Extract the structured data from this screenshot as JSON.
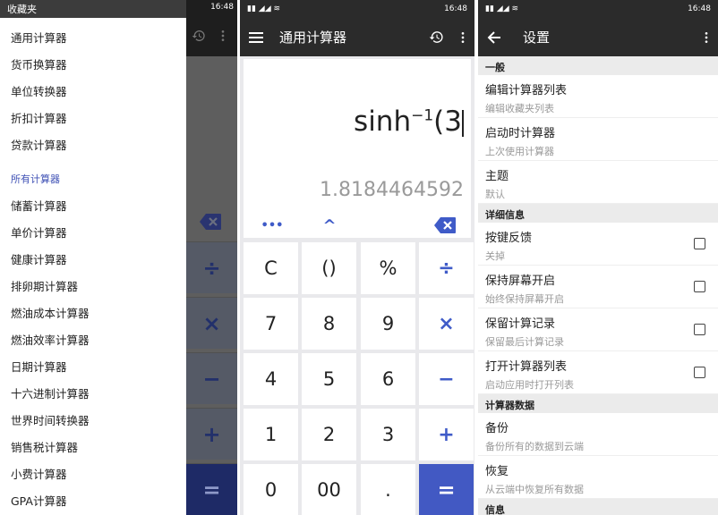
{
  "drawer": {
    "top_item": "收藏夹",
    "favorites": [
      "通用计算器",
      "货币换算器",
      "单位转换器",
      "折扣计算器",
      "贷款计算器"
    ],
    "section_title": "所有计算器",
    "all": [
      "储蓄计算器",
      "单价计算器",
      "健康计算器",
      "排卵期计算器",
      "燃油成本计算器",
      "燃油效率计算器",
      "日期计算器",
      "十六进制计算器",
      "世界时间转换器",
      "销售税计算器",
      "小费计算器",
      "GPA计算器"
    ]
  },
  "status": {
    "time": "16:48"
  },
  "calc": {
    "title": "通用计算器",
    "expr_main": "sinh",
    "expr_sup": "−1",
    "expr_tail": "(3",
    "result": "1.8184464592",
    "fn_more": "•••",
    "fn_power": "^",
    "keys": [
      [
        "C",
        "()",
        "%",
        "÷"
      ],
      [
        "7",
        "8",
        "9",
        "×"
      ],
      [
        "4",
        "5",
        "6",
        "−"
      ],
      [
        "1",
        "2",
        "3",
        "+"
      ],
      [
        "0",
        "00",
        ".",
        "="
      ]
    ]
  },
  "settings": {
    "title": "设置",
    "groups": [
      {
        "header": "一般",
        "rows": [
          {
            "title": "编辑计算器列表",
            "sub": "编辑收藏夹列表"
          },
          {
            "title": "启动时计算器",
            "sub": "上次使用计算器"
          },
          {
            "title": "主题",
            "sub": "默认"
          }
        ]
      },
      {
        "header": "详细信息",
        "rows": [
          {
            "title": "按键反馈",
            "sub": "关掉",
            "checkbox": true
          },
          {
            "title": "保持屏幕开启",
            "sub": "始终保持屏幕开启",
            "checkbox": true
          },
          {
            "title": "保留计算记录",
            "sub": "保留最后计算记录",
            "checkbox": true
          },
          {
            "title": "打开计算器列表",
            "sub": "启动应用时打开列表",
            "checkbox": true
          }
        ]
      },
      {
        "header": "计算器数据",
        "rows": [
          {
            "title": "备份",
            "sub": "备份所有的数据到云端"
          },
          {
            "title": "恢复",
            "sub": "从云端中恢复所有数据"
          }
        ]
      },
      {
        "header": "信息",
        "rows": []
      }
    ]
  },
  "colors": {
    "accent": "#4259c3",
    "bar": "#2b2b2b"
  },
  "icons": {
    "menu": "hamburger-icon",
    "history": "history-icon",
    "more": "more-vert-icon",
    "back": "arrow-left-icon",
    "backspace": "backspace-icon"
  }
}
